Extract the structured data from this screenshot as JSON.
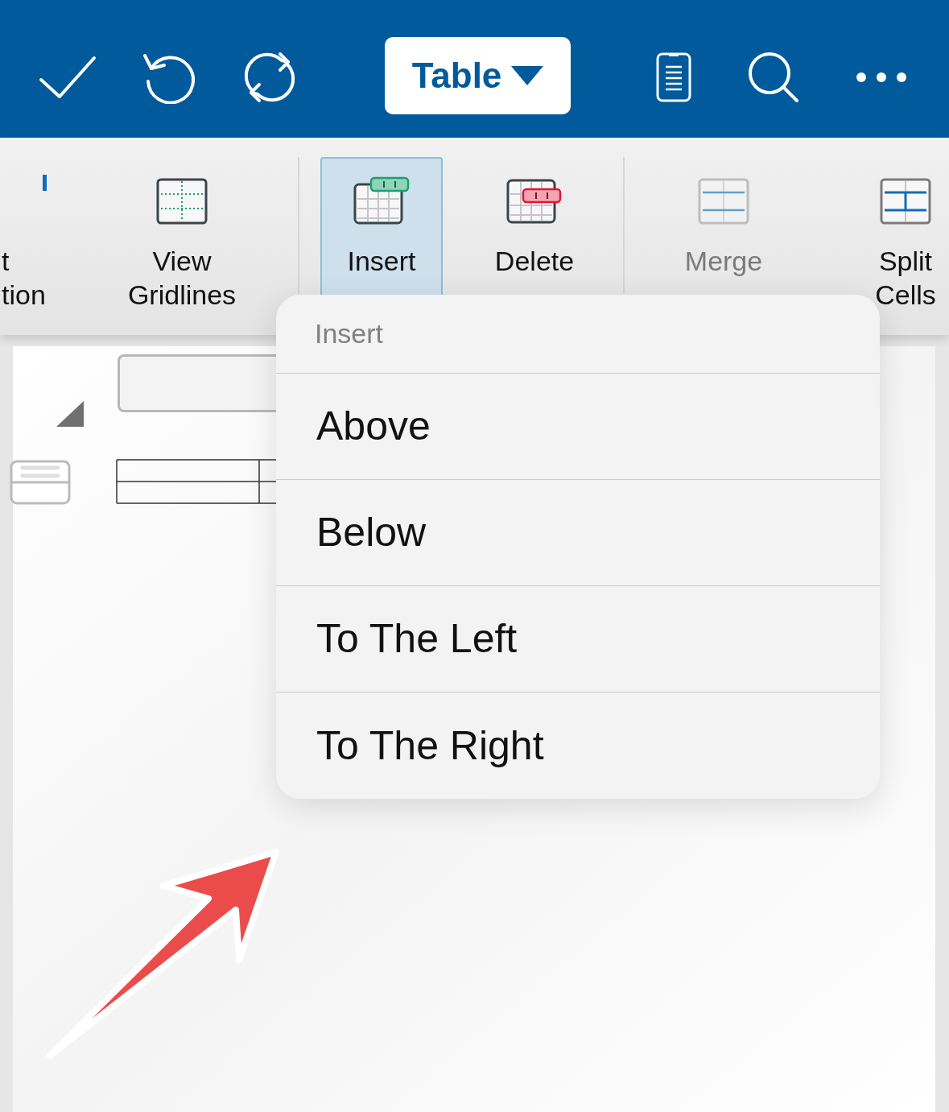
{
  "toolbar": {
    "left_buttons": [
      {
        "kind": "check"
      },
      {
        "kind": "undo"
      },
      {
        "kind": "redo"
      }
    ],
    "menu_button": {
      "label": "Table"
    },
    "right_buttons": [
      {
        "kind": "phone"
      },
      {
        "kind": "search"
      },
      {
        "kind": "more"
      }
    ]
  },
  "ribbon": {
    "items": [
      {
        "kind": "partial",
        "lines": [
          "t",
          "tion"
        ],
        "selected": false,
        "disabled": false
      },
      {
        "kind": "gridlines",
        "lines": [
          "View",
          "Gridlines"
        ],
        "selected": false,
        "disabled": false
      },
      {
        "kind": "insert",
        "lines": [
          "Insert"
        ],
        "selected": true,
        "disabled": false
      },
      {
        "kind": "delete",
        "lines": [
          "Delete"
        ],
        "selected": false,
        "disabled": false
      },
      {
        "kind": "merge",
        "lines": [
          "Merge"
        ],
        "selected": false,
        "disabled": true
      },
      {
        "kind": "split",
        "lines": [
          "Split",
          "Cells"
        ],
        "selected": false,
        "disabled": false
      }
    ]
  },
  "popover": {
    "title": "Insert",
    "options": [
      "Above",
      "Below",
      "To The Left",
      "To The Right"
    ]
  },
  "annotation": {
    "kind": "arrow"
  }
}
